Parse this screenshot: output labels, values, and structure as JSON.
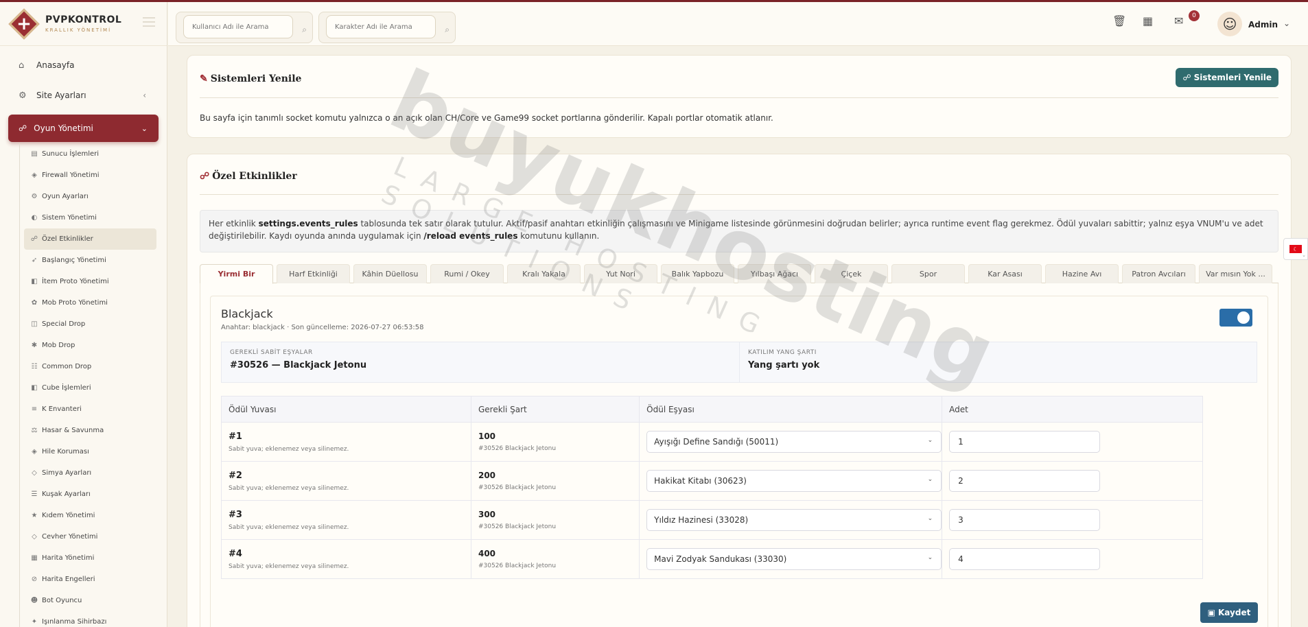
{
  "brand": {
    "name": "PVPKONTROL",
    "subtitle": "KRALLIK YÖNETİMİ"
  },
  "sidebar": {
    "main": [
      {
        "label": "Anasayfa",
        "icon": "home-icon"
      },
      {
        "label": "Site Ayarları",
        "icon": "gear-icon"
      }
    ],
    "active_section": {
      "label": "Oyun Yönetimi",
      "icon": "gamepad-icon"
    },
    "sub_items": [
      {
        "label": "Sunucu İşlemleri",
        "icon": "server-icon"
      },
      {
        "label": "Firewall Yönetimi",
        "icon": "shield-icon"
      },
      {
        "label": "Oyun Ayarları",
        "icon": "cogs-icon"
      },
      {
        "label": "Sistem Yönetimi",
        "icon": "toggle-icon"
      },
      {
        "label": "Özel Etkinlikler",
        "icon": "gamepad-icon",
        "active": true
      },
      {
        "label": "Başlangıç Yönetimi",
        "icon": "rocket-icon"
      },
      {
        "label": "İtem Proto Yönetimi",
        "icon": "cube-icon"
      },
      {
        "label": "Mob Proto Yönetimi",
        "icon": "paw-icon"
      },
      {
        "label": "Special Drop",
        "icon": "box-icon"
      },
      {
        "label": "Mob Drop",
        "icon": "bug-icon"
      },
      {
        "label": "Common Drop",
        "icon": "grid-icon"
      },
      {
        "label": "Cube İşlemleri",
        "icon": "cube-icon"
      },
      {
        "label": "K Envanteri",
        "icon": "list-icon"
      },
      {
        "label": "Hasar & Savunma",
        "icon": "scale-icon"
      },
      {
        "label": "Hile Koruması",
        "icon": "shield-icon"
      },
      {
        "label": "Simya Ayarları",
        "icon": "gem-icon"
      },
      {
        "label": "Kuşak Ayarları",
        "icon": "sliders-icon"
      },
      {
        "label": "Kıdem Yönetimi",
        "icon": "star-icon"
      },
      {
        "label": "Cevher Yönetimi",
        "icon": "gem-icon"
      },
      {
        "label": "Harita Yönetimi",
        "icon": "map-icon"
      },
      {
        "label": "Harita Engelleri",
        "icon": "ban-icon"
      },
      {
        "label": "Bot Oyuncu",
        "icon": "robot-icon"
      },
      {
        "label": "Işınlanma Sihirbazı",
        "icon": "wand-icon"
      }
    ]
  },
  "header": {
    "search_user_placeholder": "Kullanıcı Adı ile Arama",
    "search_char_placeholder": "Karakter Adı ile Arama",
    "notification_count": "0",
    "user": "Admin"
  },
  "systems_card": {
    "title": "Sistemleri Yenile",
    "button": "Sistemleri Yenile",
    "description": "Bu sayfa için tanımlı socket komutu yalnızca o an açık olan CH/Core ve Game99 socket portlarına gönderilir. Kapalı portlar otomatik atlanır."
  },
  "events_card": {
    "title": "Özel Etkinlikler",
    "info": {
      "p1": "Her etkinlik ",
      "b1": "settings.events_rules",
      "p2": " tablosunda tek satır olarak tutulur. Aktif/pasif anahtarı etkinliğin çalışmasını ve Minigame listesinde görünmesini doğrudan belirler; ayrıca runtime event flag gerekmez. Ödül yuvaları sabittir; yalnız eşya VNUM'u ve adet değiştirilebilir. Kaydı oyunda anında uygulamak için ",
      "b2": "/reload events_rules",
      "p3": " komutunu kullanın."
    },
    "tabs": [
      "Yirmi Bir",
      "Harf Etkinliği",
      "Kâhin Düellosu",
      "Rumi / Okey",
      "Kralı Yakala",
      "Yut Nori",
      "Balık Yapbozu",
      "Yılbaşı Ağacı",
      "Çiçek",
      "Spor",
      "Kar Asası",
      "Hazine Avı",
      "Patron Avcıları",
      "Var mısın Yok ..."
    ],
    "game": {
      "title": "Blackjack",
      "meta": "Anahtar: blackjack · Son güncelleme: 2026-07-27 06:53:58",
      "enabled": true,
      "required_items_label": "GEREKLİ SABİT EŞYALAR",
      "required_items_value": "#30526 — Blackjack Jetonu",
      "yang_label": "KATILIM YANG ŞARTI",
      "yang_value": "Yang şartı yok"
    },
    "table": {
      "headers": [
        "Ödül Yuvası",
        "Gerekli Şart",
        "Ödül Eşyası",
        "Adet"
      ],
      "slot_note": "Sabit yuva; eklenemez veya silinemez.",
      "rows": [
        {
          "slot": "#1",
          "cond": "100",
          "cond_note": "#30526 Blackjack Jetonu",
          "item": "Ayışığı Define Sandığı (50011)",
          "qty": "1"
        },
        {
          "slot": "#2",
          "cond": "200",
          "cond_note": "#30526 Blackjack Jetonu",
          "item": "Hakikat Kitabı (30623)",
          "qty": "2"
        },
        {
          "slot": "#3",
          "cond": "300",
          "cond_note": "#30526 Blackjack Jetonu",
          "item": "Yıldız Hazinesi (33028)",
          "qty": "3"
        },
        {
          "slot": "#4",
          "cond": "400",
          "cond_note": "#30526 Blackjack Jetonu",
          "item": "Mavi Zodyak Sandukası (33030)",
          "qty": "4"
        }
      ]
    },
    "save_button": "Kaydet"
  },
  "watermark": {
    "main": "buyukhosting",
    "sub": "LARGE HOSTING SOLUTIONS"
  },
  "colors": {
    "accent": "#8e2a30",
    "teal": "#2f6b6e",
    "save": "#2f5f7e",
    "toggle": "#2a6da8"
  }
}
